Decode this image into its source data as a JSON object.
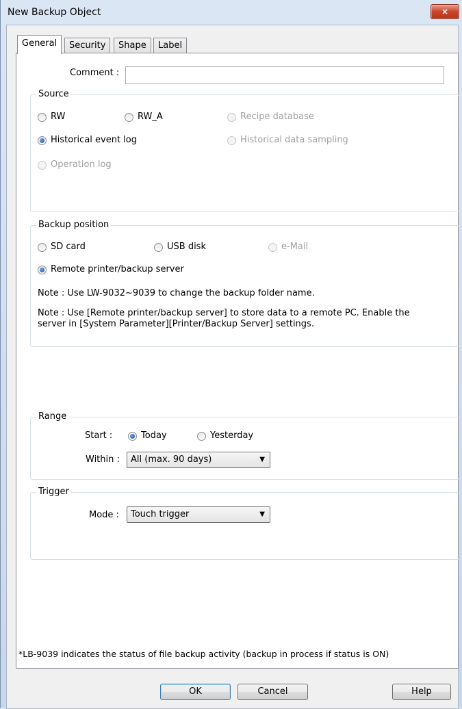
{
  "window": {
    "title": "New  Backup Object",
    "close_glyph": "×"
  },
  "tabs": [
    {
      "label": "General",
      "active": true
    },
    {
      "label": "Security"
    },
    {
      "label": "Shape"
    },
    {
      "label": "Label"
    }
  ],
  "comment": {
    "label": "Comment :",
    "value": ""
  },
  "source": {
    "legend": "Source",
    "options": {
      "rw": "RW",
      "rw_a": "RW_A",
      "recipe": "Recipe database",
      "historical_event": "Historical event log",
      "historical_data": "Historical data sampling",
      "operation": "Operation log"
    },
    "selected": "Historical event log"
  },
  "backup_position": {
    "legend": "Backup position",
    "options": {
      "sd": "SD card",
      "usb": "USB disk",
      "email": "e-Mail",
      "remote": "Remote printer/backup server"
    },
    "selected": "Remote printer/backup server",
    "note1": "Note : Use LW-9032~9039 to change the backup folder name.",
    "note2_line1": "Note : Use [Remote printer/backup server] to store data to a remote PC. Enable the",
    "note2_line2": "server in [System Parameter][Printer/Backup Server] settings."
  },
  "range": {
    "legend": "Range",
    "start_label": "Start :",
    "start_options": {
      "today": "Today",
      "yesterday": "Yesterday"
    },
    "start_selected": "Today",
    "within_label": "Within :",
    "within_value": "All (max. 90 days)"
  },
  "trigger": {
    "legend": "Trigger",
    "mode_label": "Mode :",
    "mode_value": "Touch trigger"
  },
  "footnote": "*LB-9039 indicates the status of file backup activity (backup in process if status is ON)",
  "buttons": {
    "ok": "OK",
    "cancel": "Cancel",
    "help": "Help"
  },
  "icons": {
    "dropdown": "▼"
  }
}
